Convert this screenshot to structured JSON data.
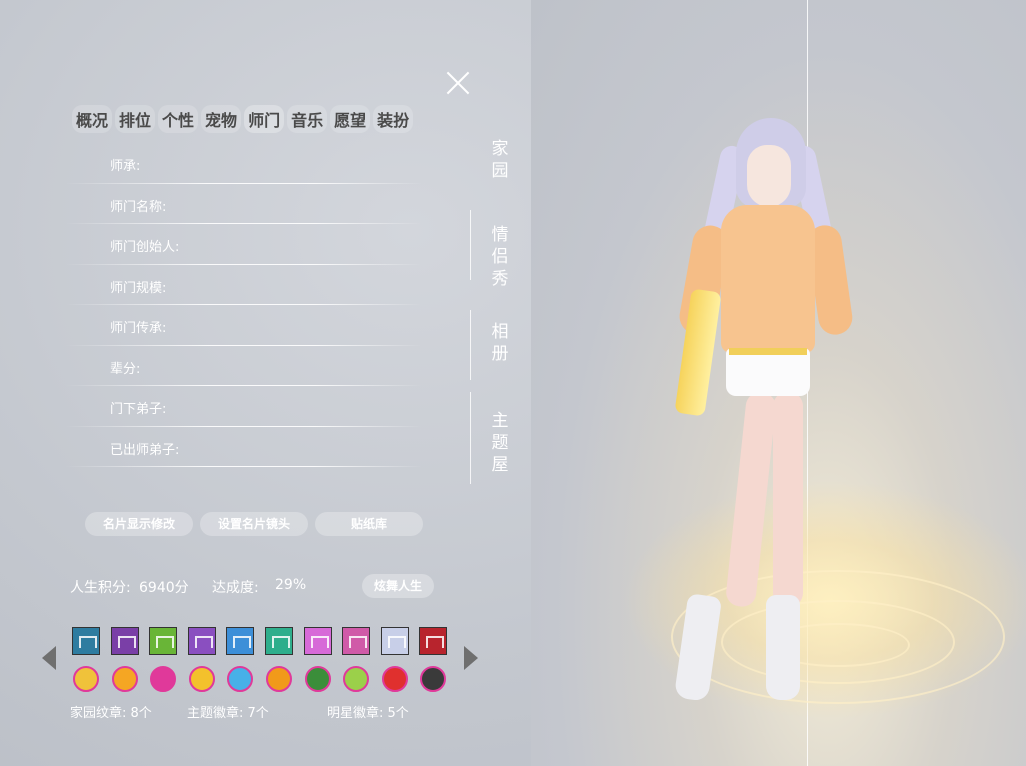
{
  "tabs": [
    {
      "label": "概况"
    },
    {
      "label": "排位"
    },
    {
      "label": "个性"
    },
    {
      "label": "宠物"
    },
    {
      "label": "师门",
      "active": true
    },
    {
      "label": "音乐"
    },
    {
      "label": "愿望"
    },
    {
      "label": "装扮"
    }
  ],
  "fields": [
    {
      "label": "师承:"
    },
    {
      "label": "师门名称:"
    },
    {
      "label": "师门创始人:"
    },
    {
      "label": "师门规模:"
    },
    {
      "label": "师门传承:"
    },
    {
      "label": "辈分:"
    },
    {
      "label": "门下弟子:"
    },
    {
      "label": "已出师弟子:"
    }
  ],
  "side_tabs": [
    {
      "label": "家园"
    },
    {
      "label": "情侣秀"
    },
    {
      "label": "相册"
    },
    {
      "label": "主题屋"
    }
  ],
  "buttons": {
    "card_display": "名片显示修改",
    "card_camera": "设置名片镜头",
    "sticker_lib": "贴纸库",
    "dance_life": "炫舞人生"
  },
  "stats": {
    "life_score_label": "人生积分:",
    "life_score_value": "6940分",
    "completion_label": "达成度:",
    "completion_value": "29%"
  },
  "badges": {
    "square": [
      {
        "icon": "home-badge-icon",
        "color": "#2e7ca0"
      },
      {
        "icon": "pavilion-badge-icon",
        "color": "#7a3fa7"
      },
      {
        "icon": "house-green-badge-icon",
        "color": "#69b537"
      },
      {
        "icon": "piano-badge-icon",
        "color": "#8a4fc0"
      },
      {
        "icon": "bath-badge-icon",
        "color": "#3d8fd8"
      },
      {
        "icon": "lotus-badge-icon",
        "color": "#2eae8c"
      },
      {
        "icon": "stage-badge-icon",
        "color": "#d76ad8"
      },
      {
        "icon": "mountain-badge-icon",
        "color": "#d05aa8"
      },
      {
        "icon": "wings-badge-icon",
        "color": "#c8cfe8"
      },
      {
        "icon": "bird-badge-icon",
        "color": "#b8242d"
      }
    ],
    "round": [
      {
        "icon": "star-badge-icon",
        "color": "#f0c23a"
      },
      {
        "icon": "sun-badge-icon",
        "color": "#f5a623"
      },
      {
        "icon": "text-badge-icon",
        "color": "#e0399a"
      },
      {
        "icon": "dancer-badge-icon",
        "color": "#f3c12c"
      },
      {
        "icon": "puzzle-badge-icon",
        "color": "#47b0e8"
      },
      {
        "icon": "leaf-badge-icon",
        "color": "#f19a1a"
      },
      {
        "icon": "tree-badge-icon",
        "color": "#3b8e3a"
      },
      {
        "icon": "palette-badge-icon",
        "color": "#9bd04a"
      },
      {
        "icon": "face-badge-icon",
        "color": "#e0302e"
      },
      {
        "icon": "lightning-badge-icon",
        "color": "#3a3a3a"
      }
    ]
  },
  "counts": {
    "home_badges": "家园纹章: 8个",
    "theme_badges": "主题徽章: 7个",
    "star_badges": "明星徽章: 5个"
  }
}
